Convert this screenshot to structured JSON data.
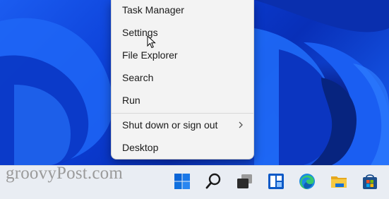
{
  "context_menu": {
    "items": [
      {
        "label": "Task Manager"
      },
      {
        "label": "Settings"
      },
      {
        "label": "File Explorer"
      },
      {
        "label": "Search"
      },
      {
        "label": "Run"
      },
      {
        "label": "Shut down or sign out",
        "has_submenu": true,
        "submenu_icon": "chevron-right-icon"
      },
      {
        "label": "Desktop"
      }
    ]
  },
  "watermark": "groovyPost.com",
  "taskbar": {
    "icons": [
      "windows-start-icon",
      "search-icon",
      "task-view-icon",
      "widgets-icon",
      "edge-icon",
      "file-explorer-icon",
      "store-icon"
    ]
  },
  "colors": {
    "wallpaper": "#0b3dbf",
    "menu_background": "#f3f3f3",
    "taskbar_background": "#e9edf3"
  }
}
